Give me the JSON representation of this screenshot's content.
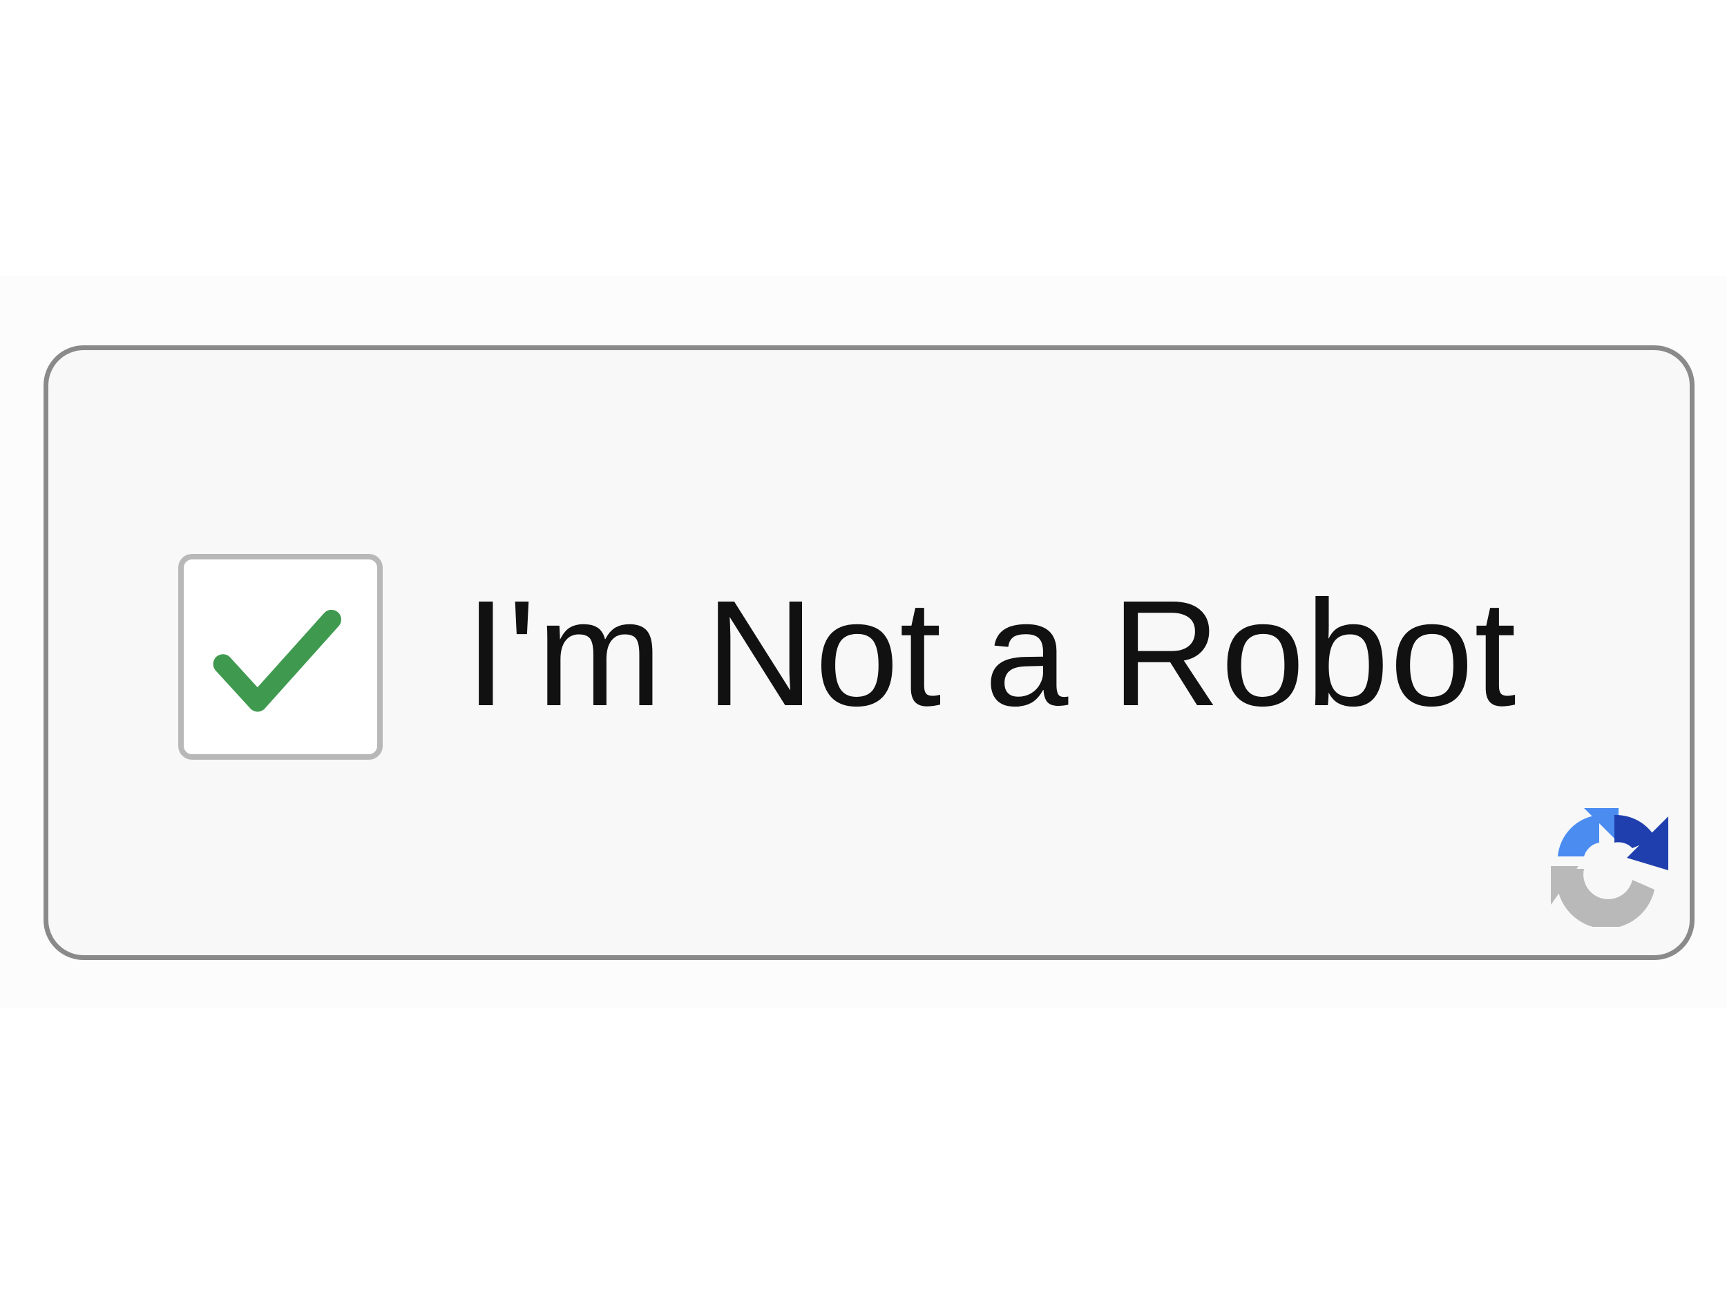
{
  "captcha": {
    "label": "I'm Not a Robot",
    "checked": true,
    "check_icon": "checkmark-icon",
    "logo_icon": "recaptcha-logo-icon",
    "colors": {
      "checkmark": "#3f9a50",
      "logo_blue_light": "#4a8cf0",
      "logo_blue_dark": "#1f3fae",
      "logo_gray": "#b9b9b9",
      "border": "#8a8a8a",
      "background": "#f8f8f8"
    }
  }
}
